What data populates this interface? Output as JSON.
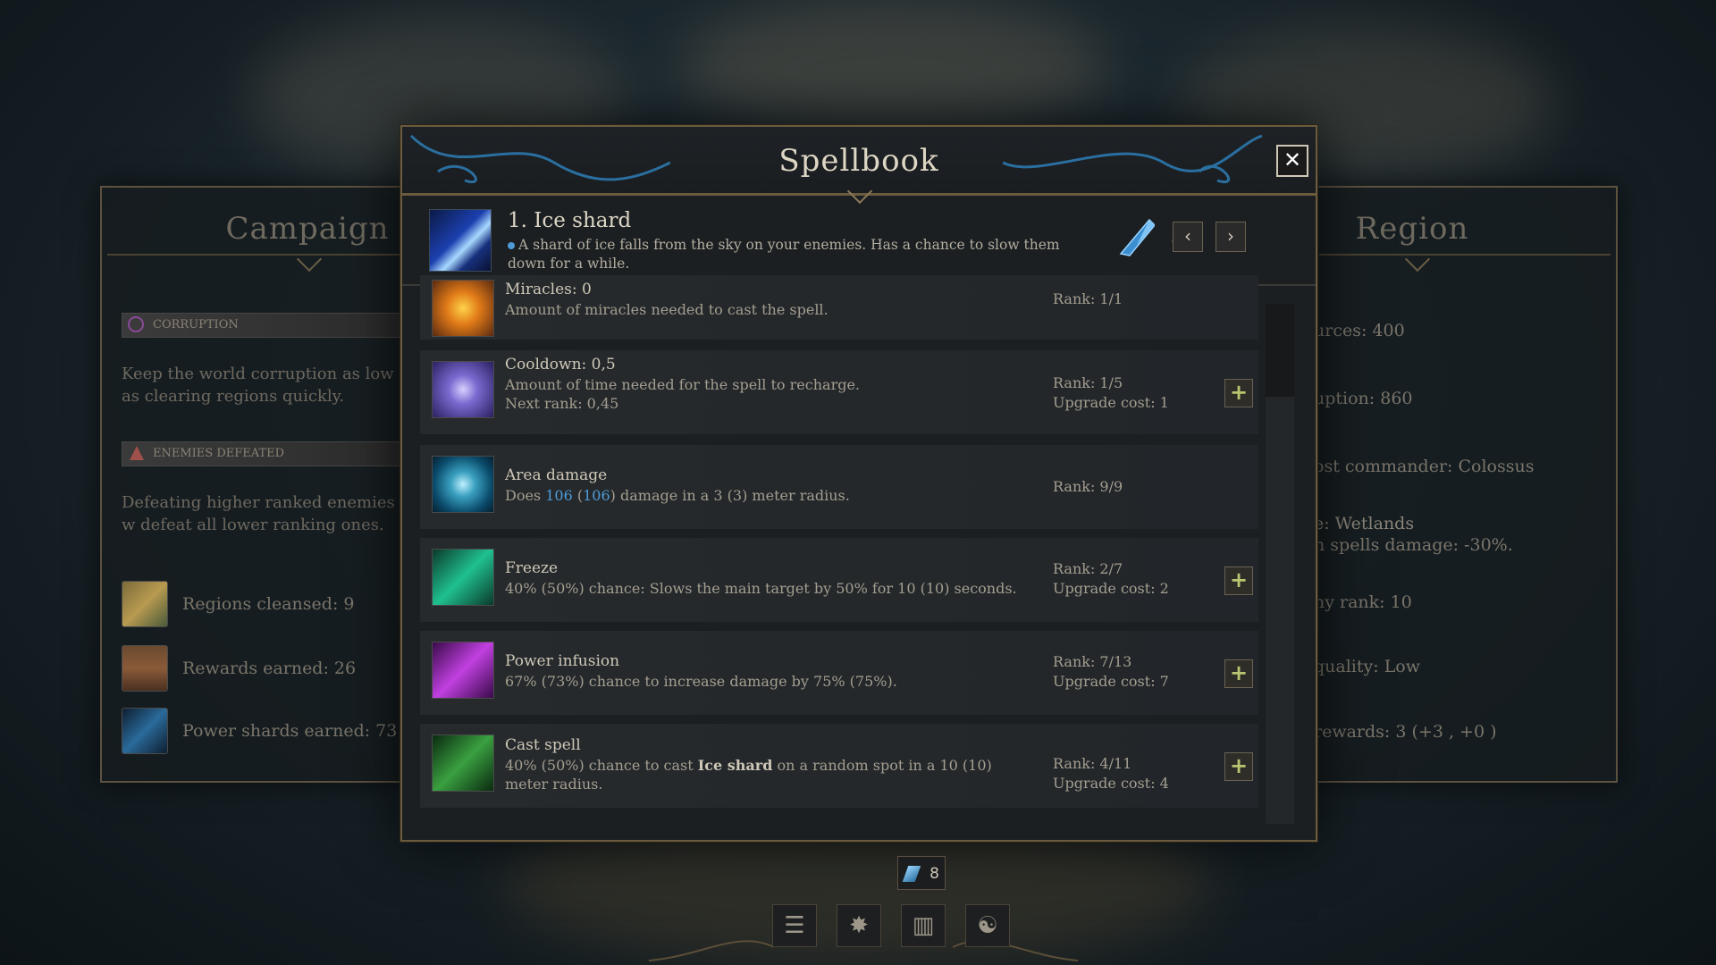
{
  "modal": {
    "title": "Spellbook",
    "close_glyph": "✕",
    "spell": {
      "name": "1. Ice shard",
      "description": "A shard of ice falls from the sky on your enemies. Has a chance to slow them down for a while.",
      "shard_count": "8",
      "prev_glyph": "‹",
      "next_glyph": "›"
    },
    "upgrades": [
      {
        "title": "Miracles: 0",
        "desc": "Amount of miracles needed to cast the spell.",
        "rank": "Rank: 1/1",
        "cost": "",
        "icon": "miracle-sun-icon"
      },
      {
        "title": "Cooldown: 0,5",
        "desc": "Amount of time needed for the spell to recharge.",
        "next": "Next rank: 0,45",
        "rank": "Rank: 1/5",
        "cost": "Upgrade cost: 1",
        "icon": "cooldown-orb-icon"
      },
      {
        "title": "Area damage",
        "desc_pre": "Does ",
        "val1": "106",
        "mid1": " (",
        "val2": "106",
        "desc_post": ") damage in a 3 (3) meter radius.",
        "rank": "Rank: 9/9",
        "cost": "",
        "icon": "vortex-icon"
      },
      {
        "title": "Freeze",
        "desc": "40% (50%) chance: Slows the main target by 50% for 10 (10) seconds.",
        "rank": "Rank: 2/7",
        "cost": "Upgrade cost: 2",
        "icon": "freeze-chevrons-icon"
      },
      {
        "title": "Power infusion",
        "desc": "67% (73%) chance to increase damage by 75% (75%).",
        "rank": "Rank: 7/13",
        "cost": "Upgrade cost: 7",
        "icon": "lightning-infusion-icon"
      },
      {
        "title": "Cast spell",
        "desc_pre": "40% (50%) chance to cast ",
        "bold": "Ice shard",
        "desc_post": " on a random spot in a 10 (10) meter radius.",
        "rank": "Rank: 4/11",
        "cost": "Upgrade cost: 4",
        "icon": "casting-hand-icon"
      }
    ],
    "plus_glyph": "+"
  },
  "campaign": {
    "title": "Campaign",
    "corruption_label": "CORRUPTION",
    "corruption_desc": "Keep the world corruption as low as clearing regions quickly.",
    "enemies_label": "ENEMIES DEFEATED",
    "enemies_desc": "Defeating higher ranked enemies w defeat all lower ranking ones.",
    "stats": [
      {
        "label": "Regions cleansed: 9"
      },
      {
        "label": "Rewards earned: 26"
      },
      {
        "label": "Power shards earned: 73"
      }
    ]
  },
  "region": {
    "title": "Region",
    "lines": [
      "urces: 400",
      "uption: 860",
      "ost commander: Colossus",
      "e: Wetlands",
      "n spells damage: -30%.",
      "ny rank: 10",
      "quality: Low",
      "rewards: 3 (+3 , +0 )"
    ]
  },
  "bottom_bar": {
    "shard_count": "8",
    "buttons": [
      "☰",
      "✸",
      "▥",
      "☯"
    ]
  },
  "colors": {
    "accent_blue": "#4e9bd8",
    "gold_border": "#6b5b3e",
    "plus_green": "#b9c670"
  }
}
